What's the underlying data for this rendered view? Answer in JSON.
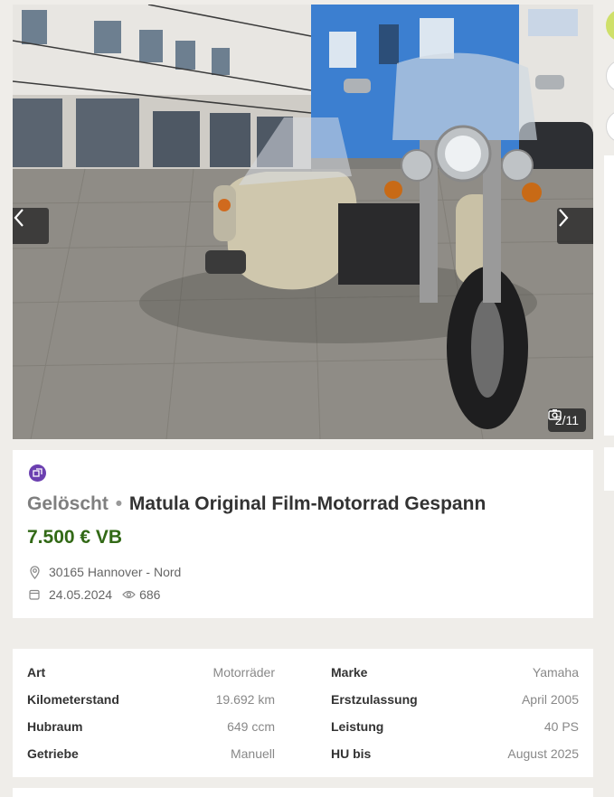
{
  "gallery": {
    "counter": "2/11",
    "prev_label": "Vorheriges Bild",
    "next_label": "Nächstes Bild"
  },
  "listing": {
    "status": "Gelöscht",
    "separator": "•",
    "title": "Matula Original Film-Motorrad Gespann",
    "price": "7.500 € VB",
    "location": "30165 Hannover - Nord",
    "date": "24.05.2024",
    "views": "686"
  },
  "details": [
    {
      "key": "Art",
      "value": "Motorräder"
    },
    {
      "key": "Marke",
      "value": "Yamaha"
    },
    {
      "key": "Kilometerstand",
      "value": "19.692 km"
    },
    {
      "key": "Erstzulassung",
      "value": "April 2005"
    },
    {
      "key": "Hubraum",
      "value": "649 ccm"
    },
    {
      "key": "Leistung",
      "value": "40 PS"
    },
    {
      "key": "Getriebe",
      "value": "Manuell"
    },
    {
      "key": "HU bis",
      "value": "August 2025"
    }
  ],
  "colors": {
    "price": "#326916",
    "status": "#7f7f7f",
    "badge": "#6b3fb0",
    "page_background": "#efede9",
    "accent": "#cfe06a"
  },
  "icons": {
    "prev": "chevron-left-icon",
    "next": "chevron-right-icon",
    "camera": "camera-icon",
    "location": "location-pin-icon",
    "calendar": "calendar-icon",
    "views": "eye-icon",
    "badge": "gallery-badge-icon"
  }
}
